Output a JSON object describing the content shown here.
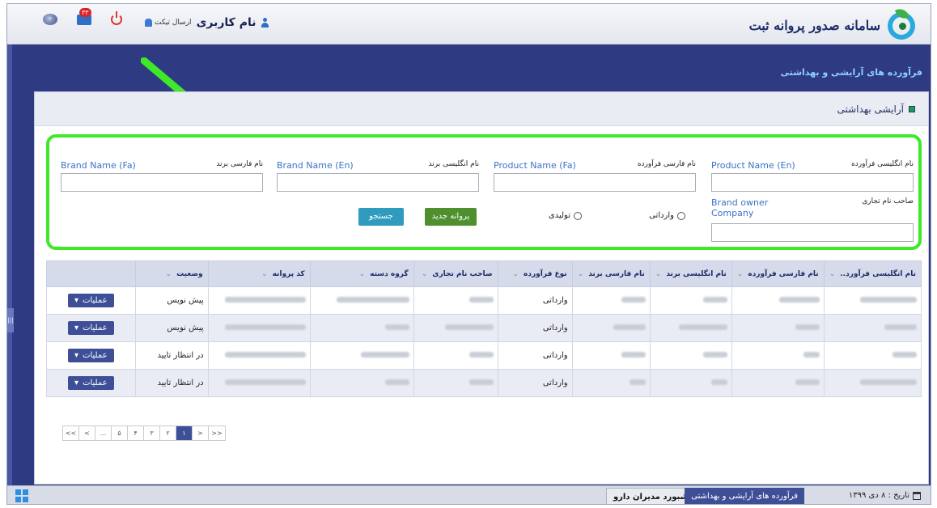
{
  "header": {
    "app_title": "سامانه صدور پروانه ثبت",
    "user_name": "نام کاربری",
    "send_ticket": "ارسال تیکت",
    "mail_badge": "۳۳",
    "subtitle": "فرآورده های آرایشی و بهداشتی"
  },
  "panel": {
    "title": "آرایشی بهداشتی"
  },
  "form": {
    "fields": [
      {
        "label_fa": "نام انگلیسی فرآورده",
        "label_en": "Product Name (En)",
        "value": ""
      },
      {
        "label_fa": "نام فارسی فرآورده",
        "label_en": "Product Name (Fa)",
        "value": ""
      },
      {
        "label_fa": "نام انگلیسی برند",
        "label_en": "Brand Name (En)",
        "value": ""
      },
      {
        "label_fa": "نام فارسی برند",
        "label_en": "Brand Name (Fa)",
        "value": ""
      },
      {
        "label_fa": "صاحب نام تجاری",
        "label_en": "Brand owner Company",
        "value": ""
      }
    ],
    "radio_import": "وارداتی",
    "radio_production": "تولیدی",
    "new_button": "پروانه جدید",
    "search_button": "جستجو"
  },
  "table": {
    "columns": [
      "نام انگلیسی فرآورد..",
      "نام فارسی فرآورده",
      "نام انگلیسی برند",
      "نام فارسی برند",
      "نوع فرآورده",
      "صاحب نام تجاری",
      "گروه دسته",
      "کد پروانه",
      "وضعیت",
      ""
    ],
    "rows": [
      {
        "type": "وارداتی",
        "status": "پیش نویس",
        "action": "عملیات"
      },
      {
        "type": "وارداتی",
        "status": "پیش نویس",
        "action": "عملیات"
      },
      {
        "type": "وارداتی",
        "status": "در انتظار تایید",
        "action": "عملیات"
      },
      {
        "type": "وارداتی",
        "status": "در انتظار تایید",
        "action": "عملیات"
      }
    ]
  },
  "pager": [
    "<<",
    "<",
    "...",
    "۵",
    "۴",
    "۳",
    "۲",
    "۱",
    ">",
    ">>"
  ],
  "taskbar": {
    "date": "تاریخ : ۸ دی ۱۳۹۹",
    "item1": "فرآورده های آرایشی و بهداشتی",
    "item2": "داشبورد مدیران دارو"
  },
  "colors": {
    "highlight": "#3fe92a",
    "primary": "#3e4f98",
    "search_button": "#2f9bbf",
    "new_button": "#4f8f2d"
  }
}
